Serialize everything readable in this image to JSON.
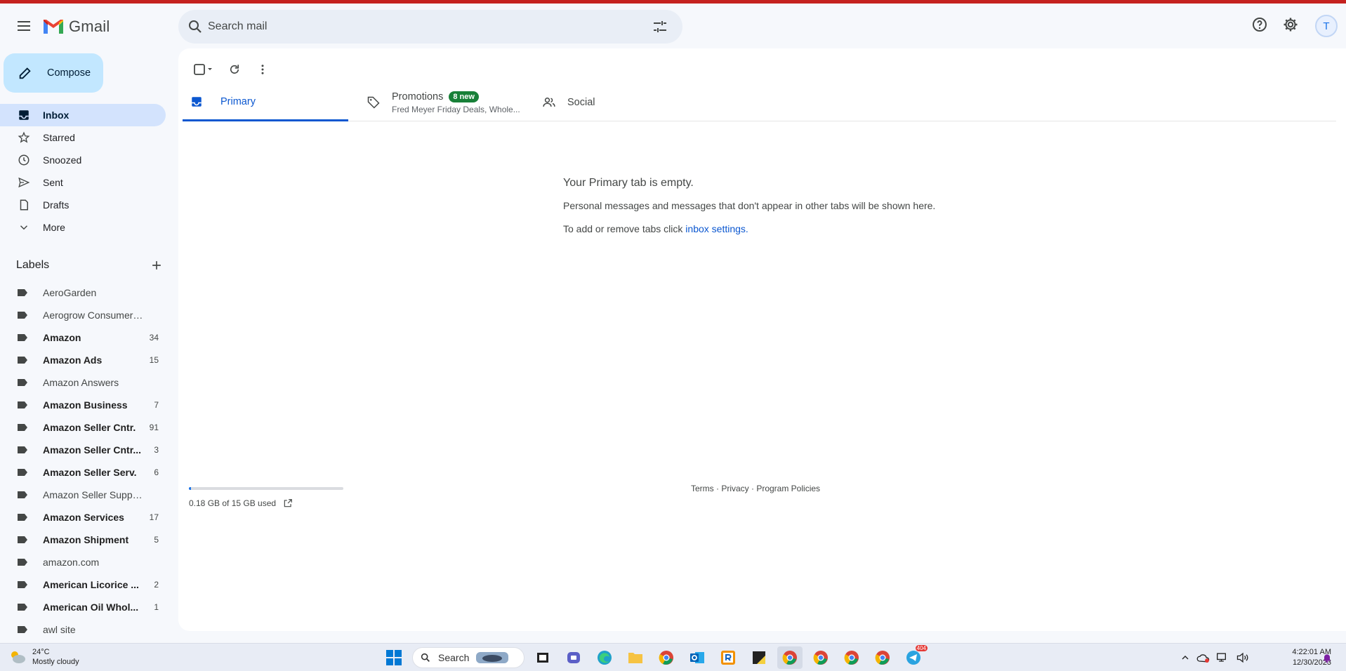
{
  "app": {
    "name": "Gmail"
  },
  "search": {
    "placeholder": "Search mail"
  },
  "header": {
    "avatar_initial": "T"
  },
  "sidebar": {
    "compose_label": "Compose",
    "nav": [
      {
        "label": "Inbox",
        "icon": "inbox-icon",
        "active": true
      },
      {
        "label": "Starred",
        "icon": "star-icon"
      },
      {
        "label": "Snoozed",
        "icon": "clock-icon"
      },
      {
        "label": "Sent",
        "icon": "send-icon"
      },
      {
        "label": "Drafts",
        "icon": "draft-icon"
      },
      {
        "label": "More",
        "icon": "chevron-down-icon"
      }
    ],
    "labels_title": "Labels",
    "labels": [
      {
        "name": "AeroGarden",
        "count": "",
        "bold": false
      },
      {
        "name": "Aerogrow Consumer Se...",
        "count": "",
        "bold": false
      },
      {
        "name": "Amazon",
        "count": "34",
        "bold": true
      },
      {
        "name": "Amazon Ads",
        "count": "15",
        "bold": true
      },
      {
        "name": "Amazon Answers",
        "count": "",
        "bold": false
      },
      {
        "name": "Amazon Business",
        "count": "7",
        "bold": true
      },
      {
        "name": "Amazon Seller Cntr.",
        "count": "91",
        "bold": true
      },
      {
        "name": "Amazon Seller Cntr...",
        "count": "3",
        "bold": true
      },
      {
        "name": "Amazon Seller Serv.",
        "count": "6",
        "bold": true
      },
      {
        "name": "Amazon Seller Support",
        "count": "",
        "bold": false
      },
      {
        "name": "Amazon Services",
        "count": "17",
        "bold": true
      },
      {
        "name": "Amazon Shipment",
        "count": "5",
        "bold": true
      },
      {
        "name": "amazon.com",
        "count": "",
        "bold": false
      },
      {
        "name": "American Licorice ...",
        "count": "2",
        "bold": true
      },
      {
        "name": "American Oil Whol...",
        "count": "1",
        "bold": true
      },
      {
        "name": "awl site",
        "count": "",
        "bold": false
      }
    ]
  },
  "tabs": {
    "primary": "Primary",
    "promotions": "Promotions",
    "promotions_badge": "8 new",
    "promotions_sub": "Fred Meyer Friday Deals, Whole...",
    "social": "Social"
  },
  "empty": {
    "title": "Your Primary tab is empty.",
    "line1": "Personal messages and messages that don't appear in other tabs will be shown here.",
    "line2_prefix": "To add or remove tabs click ",
    "line2_link": "inbox settings",
    "line2_suffix": "."
  },
  "storage": {
    "text": "0.18 GB of 15 GB used",
    "fraction": 0.012
  },
  "footer": {
    "text": "Terms · Privacy · Program Policies"
  },
  "taskbar": {
    "weather_temp": "24°C",
    "weather_desc": "Mostly cloudy",
    "search_label": "Search",
    "time": "4:22:01 AM",
    "date": "12/30/2023",
    "telegram_badge": "404"
  },
  "colors": {
    "accent": "#0b57d0",
    "compose_bg": "#c2e7ff",
    "active_nav": "#d3e3fd",
    "badge_green": "#188038",
    "top_stripe": "#c5221f"
  }
}
